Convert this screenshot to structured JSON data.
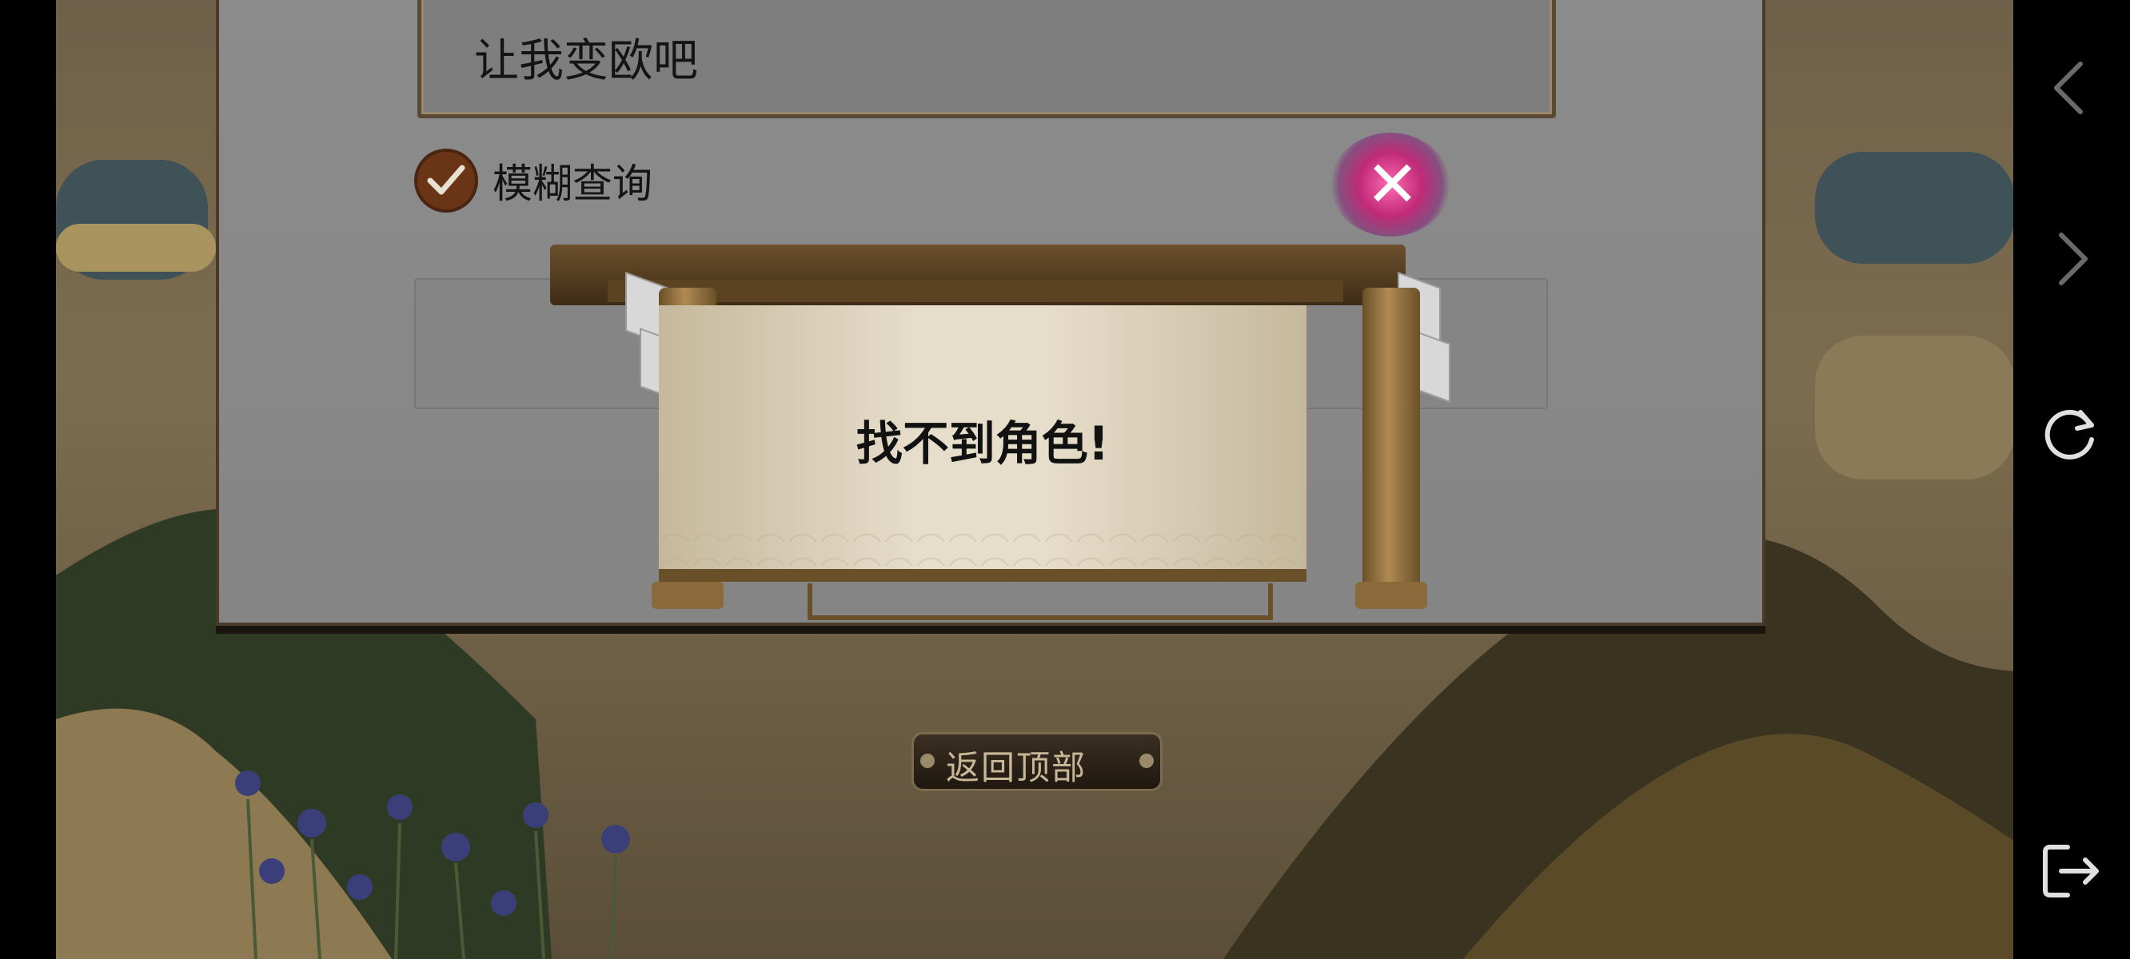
{
  "search": {
    "query_value": "让我变欧吧"
  },
  "fuzzy_query": {
    "label": "模糊查询",
    "checked": true
  },
  "dialog": {
    "message": "找不到角色!"
  },
  "back_to_top": {
    "label": "返回顶部"
  },
  "nav_bar": {
    "icons": [
      "back-chevron-icon",
      "forward-chevron-icon",
      "refresh-icon",
      "exit-icon"
    ]
  },
  "colors": {
    "check_fill": "#6a3516",
    "close_glow": "#c02a78",
    "nav_icon": "#d8d8d8"
  }
}
